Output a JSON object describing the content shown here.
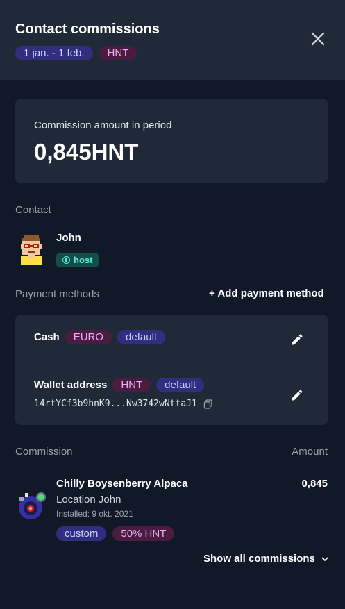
{
  "header": {
    "title": "Contact commissions",
    "period": "1 jan. - 1 feb.",
    "currency": "HNT"
  },
  "summary": {
    "label": "Commission amount in period",
    "value": "0,845HNT"
  },
  "contact": {
    "section_label": "Contact",
    "name": "John",
    "role_badge": "host",
    "role_icon": "dollar-circle-icon"
  },
  "payment_methods": {
    "section_label": "Payment methods",
    "add_label": "+ Add payment method",
    "items": [
      {
        "name": "Cash",
        "currency": "EURO",
        "tag": "default"
      },
      {
        "name": "Wallet address",
        "currency": "HNT",
        "tag": "default",
        "address": "14rtYCf3b9hnK9...Nw3742wNttaJ1"
      }
    ]
  },
  "commissions": {
    "column_left": "Commission",
    "column_right": "Amount",
    "items": [
      {
        "name": "Chilly Boysenberry Alpaca",
        "location": "Location John",
        "installed": "Installed: 9 okt. 2021",
        "amount": "0,845",
        "type_badge": "custom",
        "share_badge": "50% HNT"
      }
    ],
    "show_all_label": "Show all commissions"
  },
  "colors": {
    "background": "#111827",
    "card": "#1f2937",
    "badge_blue_bg": "#312e81",
    "badge_pink_bg": "#4a1d3f",
    "badge_teal_bg": "#134e4a",
    "accent_teal": "#5eead4"
  }
}
